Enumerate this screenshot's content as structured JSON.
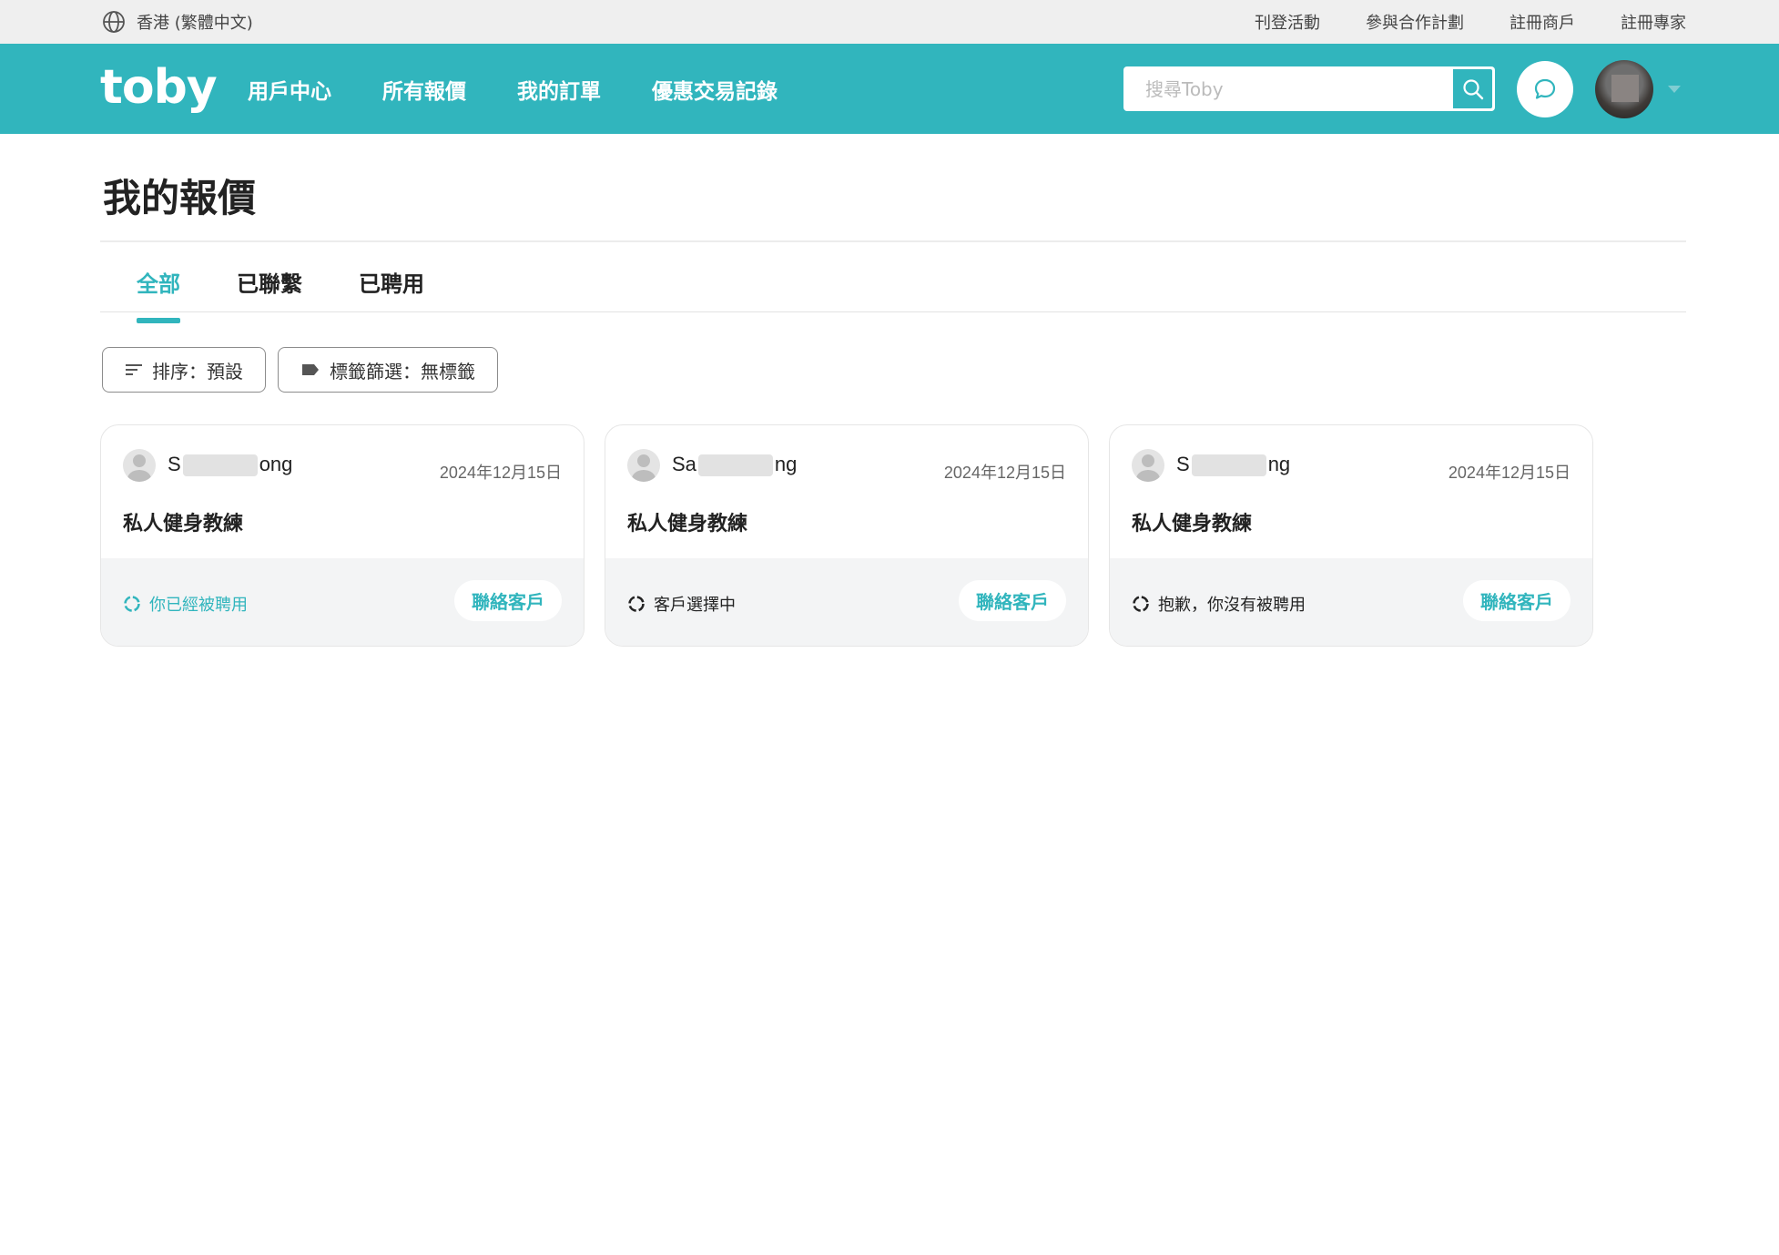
{
  "utilbar": {
    "locale": "香港 (繁體中文)",
    "links": [
      "刊登活動",
      "參與合作計劃",
      "註冊商戶",
      "註冊專家"
    ]
  },
  "header": {
    "logo": "toby",
    "nav": [
      "用戶中心",
      "所有報價",
      "我的訂單",
      "優惠交易記錄"
    ],
    "search_placeholder": "搜尋Toby"
  },
  "page": {
    "title": "我的報價",
    "tabs": [
      "全部",
      "已聯繫",
      "已聘用"
    ],
    "active_tab": "全部",
    "filters": {
      "sort": "排序：預設",
      "tag": "標籤篩選：無標籤"
    }
  },
  "cards": [
    {
      "name_start": "S",
      "name_end": "ong",
      "date": "2024年12月15日",
      "service": "私人健身教練",
      "status": "你已經被聘用",
      "contact": "聯絡客戶"
    },
    {
      "name_start": "Sa",
      "name_end": "ng",
      "date": "2024年12月15日",
      "service": "私人健身教練",
      "status": "客戶選擇中",
      "contact": "聯絡客戶"
    },
    {
      "name_start": "S",
      "name_end": "ng",
      "date": "2024年12月15日",
      "service": "私人健身教練",
      "status": "抱歉，你沒有被聘用",
      "contact": "聯絡客戶"
    }
  ],
  "colors": {
    "brand": "#31b5bd",
    "utilbar": "#efefef",
    "card_footer": "#f3f4f5"
  }
}
